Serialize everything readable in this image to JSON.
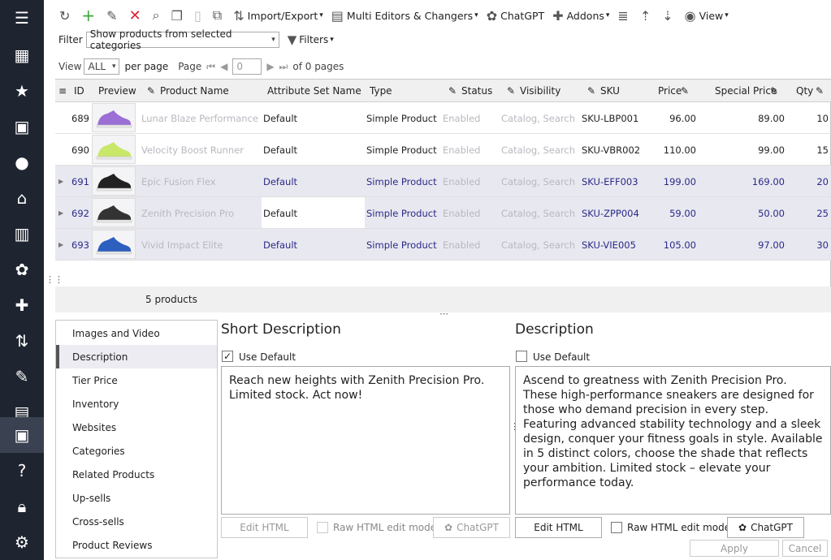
{
  "sidebar": {
    "items": [
      {
        "name": "menu-icon",
        "glyph": "☰"
      },
      {
        "name": "store-icon",
        "glyph": "▦"
      },
      {
        "name": "star-icon",
        "glyph": "★"
      },
      {
        "name": "inbox-icon",
        "glyph": "▣"
      },
      {
        "name": "user-icon",
        "glyph": "●"
      },
      {
        "name": "basket-icon",
        "glyph": "⌂"
      },
      {
        "name": "chart-icon",
        "glyph": "▥"
      },
      {
        "name": "chatgpt-icon",
        "glyph": "✿"
      },
      {
        "name": "puzzle-icon",
        "glyph": "✚"
      },
      {
        "name": "sort-icon",
        "glyph": "⇅"
      },
      {
        "name": "wrench-icon",
        "glyph": "✎"
      },
      {
        "name": "suitcase-icon",
        "glyph": "▤"
      },
      {
        "name": "box-icon",
        "glyph": "▣"
      },
      {
        "name": "help-icon",
        "glyph": "?"
      },
      {
        "name": "lock-icon",
        "glyph": "🔒︎"
      },
      {
        "name": "settings-icon",
        "glyph": "⚙"
      }
    ]
  },
  "toolbar": {
    "import_export": "Import/Export",
    "multi_editors": "Multi Editors & Changers",
    "chatgpt": "ChatGPT",
    "addons": "Addons",
    "view": "View"
  },
  "filter": {
    "label": "Filter",
    "value": "Show products from selected categories",
    "filters_label": "Filters"
  },
  "pager": {
    "view_label": "View",
    "view_value": "ALL",
    "per_page": "per page",
    "page_label": "Page",
    "page_value": "0",
    "of_pages": "of 0 pages"
  },
  "grid": {
    "columns": [
      "ID",
      "Preview",
      "Product Name",
      "Attribute Set Name",
      "Type",
      "Status",
      "Visibility",
      "SKU",
      "Price",
      "Special Price",
      "Qty"
    ],
    "rows": [
      {
        "id": "689",
        "name": "Lunar Blaze Performance",
        "attr": "Default",
        "type": "Simple Product",
        "status": "Enabled",
        "visibility": "Catalog, Search",
        "sku": "SKU-LBP001",
        "price": "96.00",
        "special": "89.00",
        "qty": "10",
        "shoe_color": "#9b6fd6"
      },
      {
        "id": "690",
        "name": "Velocity Boost Runner",
        "attr": "Default",
        "type": "Simple Product",
        "status": "Enabled",
        "visibility": "Catalog, Search",
        "sku": "SKU-VBR002",
        "price": "110.00",
        "special": "99.00",
        "qty": "15",
        "shoe_color": "#c9e86a"
      },
      {
        "id": "691",
        "name": "Epic Fusion Flex",
        "attr": "Default",
        "type": "Simple Product",
        "status": "Enabled",
        "visibility": "Catalog, Search",
        "sku": "SKU-EFF003",
        "price": "199.00",
        "special": "169.00",
        "qty": "20",
        "shoe_color": "#222222"
      },
      {
        "id": "692",
        "name": "Zenith Precision Pro",
        "attr": "Default",
        "type": "Simple Product",
        "status": "Enabled",
        "visibility": "Catalog, Search",
        "sku": "SKU-ZPP004",
        "price": "59.00",
        "special": "50.00",
        "qty": "25",
        "shoe_color": "#333333"
      },
      {
        "id": "693",
        "name": "Vivid Impact Elite",
        "attr": "Default",
        "type": "Simple Product",
        "status": "Enabled",
        "visibility": "Catalog, Search",
        "sku": "SKU-VIE005",
        "price": "105.00",
        "special": "97.00",
        "qty": "30",
        "shoe_color": "#2d5fbf"
      }
    ],
    "footer": "5 products"
  },
  "leftnav": {
    "items": [
      "Images and Video",
      "Description",
      "Tier Price",
      "Inventory",
      "Websites",
      "Categories",
      "Related Products",
      "Up-sells",
      "Cross-sells",
      "Product Reviews"
    ]
  },
  "short_desc": {
    "title": "Short Description",
    "use_default": "Use Default",
    "text": "Reach new heights with Zenith Precision Pro. Limited stock. Act now!",
    "edit_html": "Edit HTML",
    "raw_html": "Raw HTML edit mode",
    "chatgpt": "ChatGPT"
  },
  "desc": {
    "title": "Description",
    "use_default": "Use Default",
    "text": "Ascend to greatness with Zenith Precision Pro. These high-performance sneakers are designed for those who demand precision in every step. Featuring advanced stability technology and a sleek design, conquer your fitness goals in style. Available in 5 distinct colors, choose the shade that reflects your ambition. Limited stock – elevate your performance today.",
    "edit_html": "Edit HTML",
    "raw_html": "Raw HTML edit mode",
    "chatgpt": "ChatGPT"
  },
  "actions": {
    "apply": "Apply",
    "cancel": "Cancel"
  }
}
